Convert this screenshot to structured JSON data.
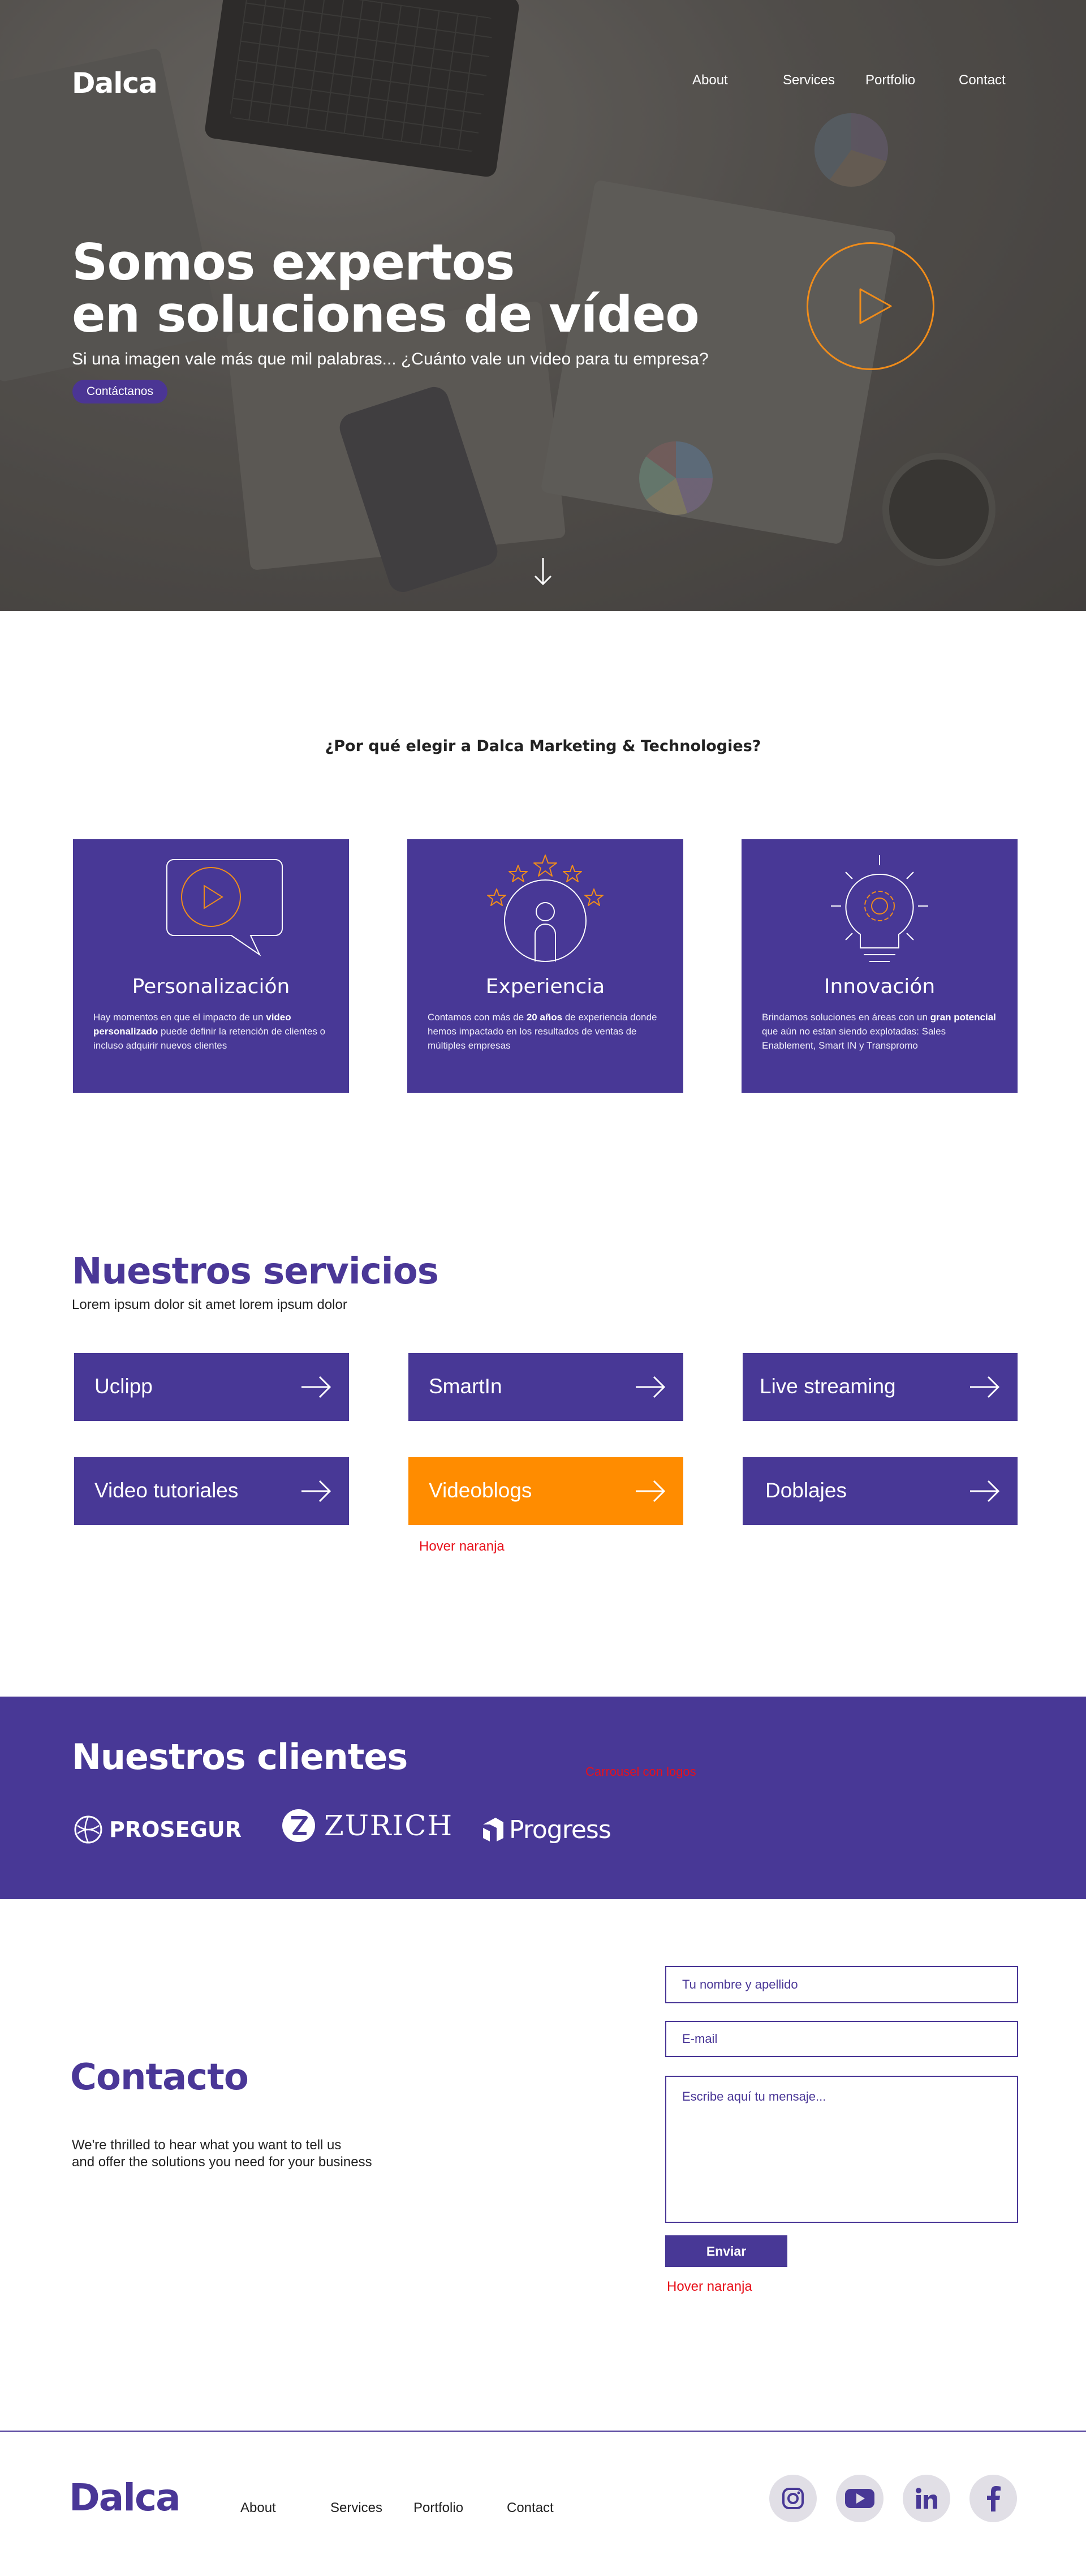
{
  "brand": {
    "logo": "Dalca",
    "primary_color": "#483896",
    "accent_color": "#ff8c00",
    "note_color": "#e8101a"
  },
  "nav": {
    "items": [
      "About",
      "Services",
      "Portfolio",
      "Contact"
    ]
  },
  "hero": {
    "title_line1": "Somos expertos",
    "title_line2": "en soluciones de vídeo",
    "subtitle": "Si una imagen vale más que mil palabras... ¿Cuánto vale un video para tu empresa?",
    "cta": "Contáctanos",
    "play_icon": "play-circle-icon",
    "scroll_icon": "arrow-down-icon"
  },
  "why": {
    "title": "¿Por qué elegir a Dalca Marketing & Technologies?",
    "features": [
      {
        "icon": "video-chat-icon",
        "title": "Personalización",
        "desc_1": "Hay momentos en que el impacto de un ",
        "desc_bold": "video personalizado",
        "desc_2": " puede definir la retención de clientes o incluso adquirir nuevos clientes"
      },
      {
        "icon": "star-person-icon",
        "title": "Experiencia",
        "desc_1": "Contamos con más de ",
        "desc_bold": "20 años",
        "desc_2": " de experiencia donde hemos impactado en los resultados de ventas de múltiples empresas"
      },
      {
        "icon": "lightbulb-gear-icon",
        "title": "Innovación",
        "desc_1": "Brindamos soluciones en áreas con un ",
        "desc_bold": "gran potencial",
        "desc_2": " que aún no estan siendo explotadas: Sales Enablement, Smart IN y Transpromo"
      }
    ]
  },
  "services": {
    "title": "Nuestros servicios",
    "subtitle": "Lorem ipsum dolor sit amet lorem ipsum dolor",
    "items": [
      "Uclipp",
      "SmartIn",
      "Live streaming",
      "Video tutoriales",
      "Videoblogs",
      "Doblajes"
    ],
    "hover_note": "Hover naranja"
  },
  "clients": {
    "title": "Nuestros clientes",
    "carousel_note": "Carrousel con logos",
    "logos": [
      "PROSEGUR",
      "ZURICH",
      "Progress"
    ]
  },
  "contact": {
    "title": "Contacto",
    "text_line1": "We're thrilled to hear what you want to tell us",
    "text_line2": "and offer the solutions you need for your business",
    "name_placeholder": "Tu nombre y apellido",
    "email_placeholder": "E-mail",
    "message_placeholder": "Escribe aquí tu mensaje...",
    "send": "Enviar",
    "hover_note": "Hover naranja"
  },
  "footer": {
    "logo": "Dalca",
    "nav": [
      "About",
      "Services",
      "Portfolio",
      "Contact"
    ],
    "social": [
      "instagram-icon",
      "youtube-icon",
      "linkedin-icon",
      "facebook-icon"
    ]
  }
}
